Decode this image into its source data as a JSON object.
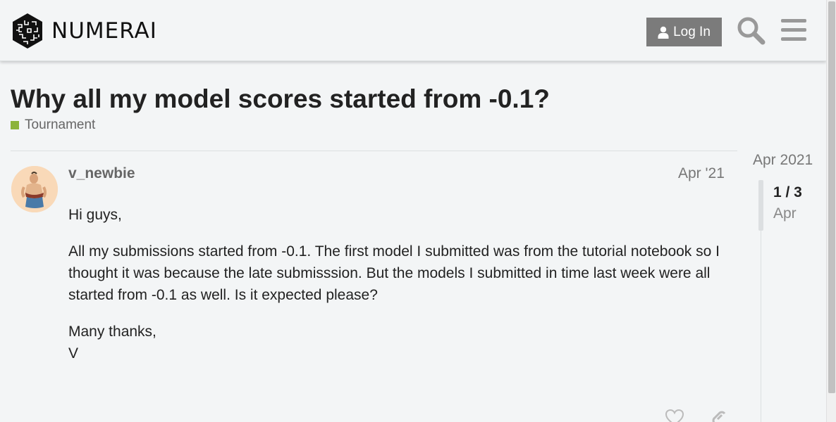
{
  "header": {
    "brand": "NUMERAI",
    "login_label": "Log In"
  },
  "topic": {
    "title": "Why all my model scores started from -0.1?",
    "category": "Tournament",
    "category_color": "#8cb33a"
  },
  "post": {
    "username": "v_newbie",
    "date": "Apr '21",
    "paragraphs": [
      "Hi guys,",
      "All my submissions started from -0.1. The first model I submitted was from the tutorial notebook so I thought it was because the late submisssion. But the models I submitted in time last week were all started from -0.1 as well. Is it expected please?"
    ],
    "signoff_line1": "Many thanks,",
    "signoff_line2": "V"
  },
  "timeline": {
    "start_label": "Apr 2021",
    "count": "1 / 3",
    "current_date": "Apr"
  },
  "icons": {
    "user": "user-icon",
    "search": "search-icon",
    "menu": "hamburger-menu-icon",
    "like": "heart-icon",
    "link": "link-icon"
  }
}
